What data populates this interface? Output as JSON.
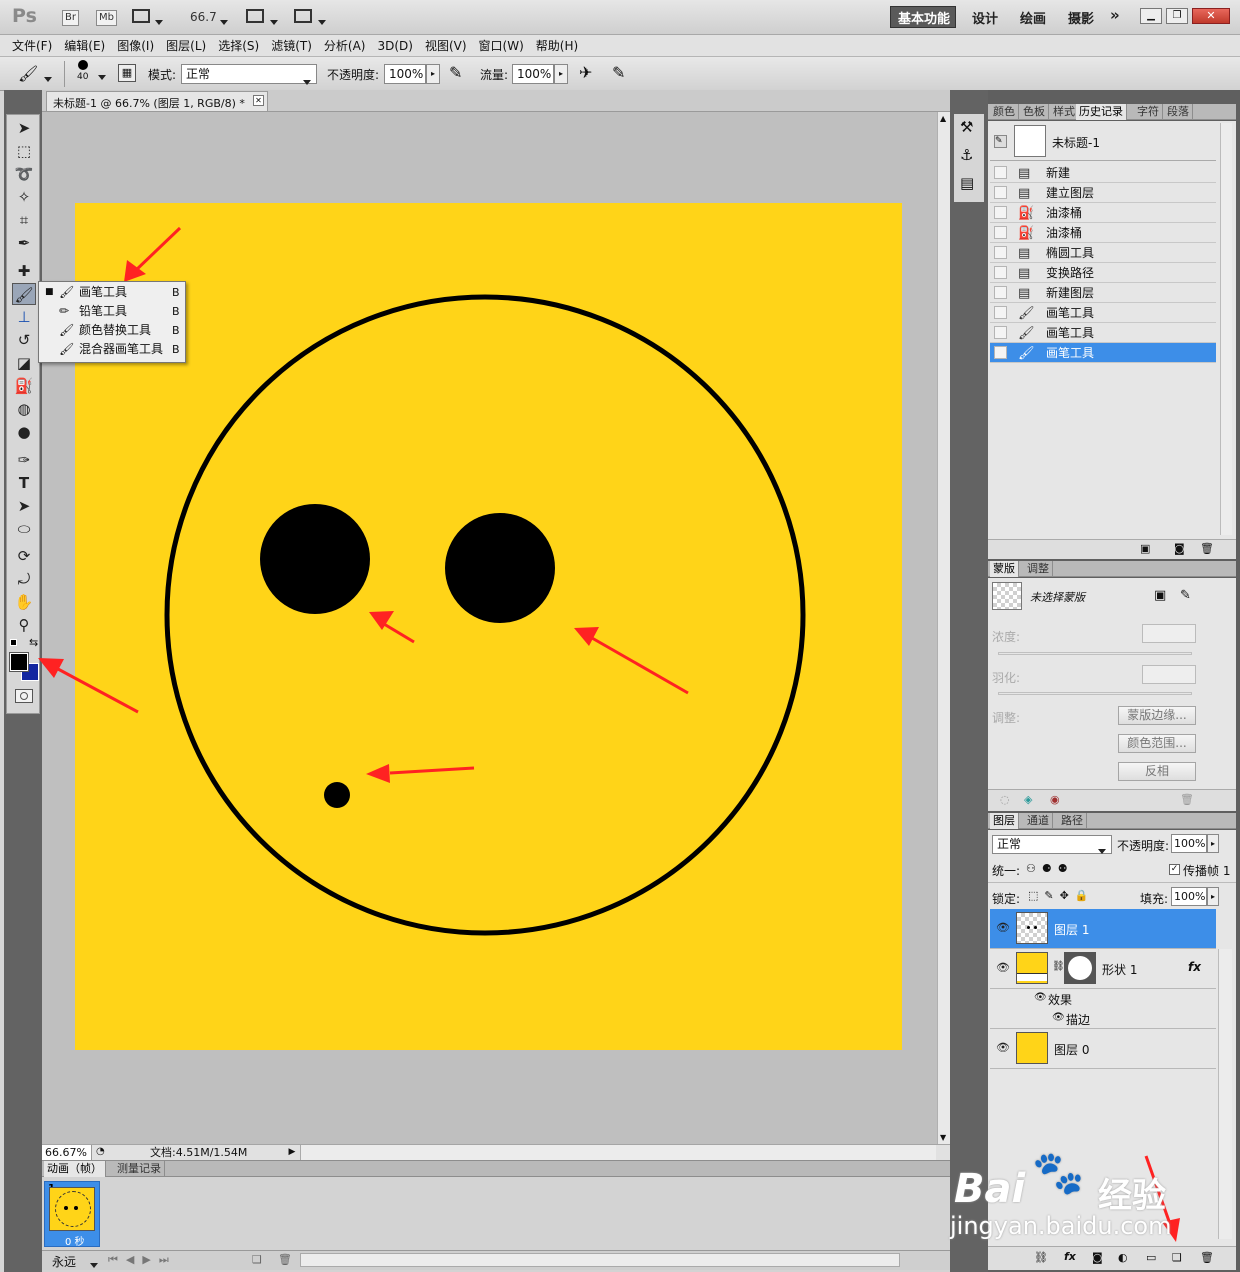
{
  "app": {
    "logo": "Ps",
    "bridge": "Br",
    "minibridge": "Mb",
    "zoom_menu": "66.7",
    "workspaces": [
      "基本功能",
      "设计",
      "绘画",
      "摄影"
    ],
    "more": "»"
  },
  "menubar": [
    "文件(F)",
    "编辑(E)",
    "图像(I)",
    "图层(L)",
    "选择(S)",
    "滤镜(T)",
    "分析(A)",
    "3D(D)",
    "视图(V)",
    "窗口(W)",
    "帮助(H)"
  ],
  "options": {
    "brush_size": "40",
    "mode_label": "模式:",
    "mode_value": "正常",
    "opacity_label": "不透明度:",
    "opacity_value": "100%",
    "flow_label": "流量:",
    "flow_value": "100%"
  },
  "document": {
    "tab_title": "未标题-1 @ 66.7% (图层 1, RGB/8) *",
    "zoom": "66.67%",
    "doc_size": "文档:4.51M/1.54M",
    "colors": {
      "background": "#ffd418",
      "ink": "#000000",
      "arrow": "#ff2222",
      "selection": "#3d8ee8"
    }
  },
  "flyout": {
    "items": [
      {
        "name": "画笔工具",
        "key": "B",
        "selected": true
      },
      {
        "name": "铅笔工具",
        "key": "B",
        "selected": false
      },
      {
        "name": "颜色替换工具",
        "key": "B",
        "selected": false
      },
      {
        "name": "混合器画笔工具",
        "key": "B",
        "selected": false
      }
    ]
  },
  "animation": {
    "tabs": [
      "动画（帧）",
      "测量记录"
    ],
    "frame_number": "1",
    "frame_time": "0 秒",
    "loop": "永远"
  },
  "history_panel": {
    "tabs": [
      "颜色",
      "色板",
      "样式",
      "历史记录",
      "字符",
      "段落"
    ],
    "snapshot": "未标题-1",
    "items": [
      "新建",
      "建立图层",
      "油漆桶",
      "油漆桶",
      "椭圆工具",
      "变换路径",
      "新建图层",
      "画笔工具",
      "画笔工具",
      "画笔工具"
    ]
  },
  "masks_panel": {
    "tabs": [
      "蒙版",
      "调整"
    ],
    "none_selected": "未选择蒙版",
    "density": "浓度:",
    "feather": "羽化:",
    "refine": "调整:",
    "buttons": [
      "蒙版边缘...",
      "颜色范围...",
      "反相"
    ]
  },
  "layers_panel": {
    "tabs": [
      "图层",
      "通道",
      "路径"
    ],
    "blend_mode": "正常",
    "opacity_label": "不透明度:",
    "opacity_value": "100%",
    "unify_label": "统一:",
    "propagate": "传播帧 1",
    "lock_label": "锁定:",
    "fill_label": "填充:",
    "fill_value": "100%",
    "layers": [
      {
        "name": "图层 1",
        "selected": true
      },
      {
        "name": "形状 1",
        "selected": false
      },
      {
        "name": "效果",
        "selected": false
      },
      {
        "name": "描边",
        "selected": false
      },
      {
        "name": "图层 0",
        "selected": false
      }
    ],
    "fx": "fx"
  },
  "watermark": {
    "brand": "Bai",
    "brand2": "经验",
    "url": "jingyan.baidu.com"
  }
}
